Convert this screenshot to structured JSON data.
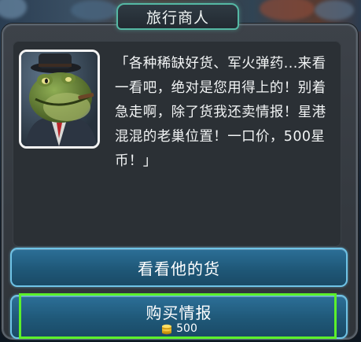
{
  "dialog": {
    "title": "旅行商人",
    "message": "「各种稀缺好货、军火弹药...来看一看吧，绝对是您用得上的！别着急走啊，除了货我还卖情报！星港混混的老巢位置！一口价，500星币！」"
  },
  "buttons": {
    "browse_label": "看看他的货",
    "buy_label": "购买情报",
    "buy_price": "500"
  },
  "icons": {
    "portrait": "frog-merchant-portrait",
    "currency": "coin-stack-icon"
  },
  "colors": {
    "highlight": "#5cf02a",
    "button_border": "#6fc3e6",
    "title_border": "#55b8a4"
  }
}
